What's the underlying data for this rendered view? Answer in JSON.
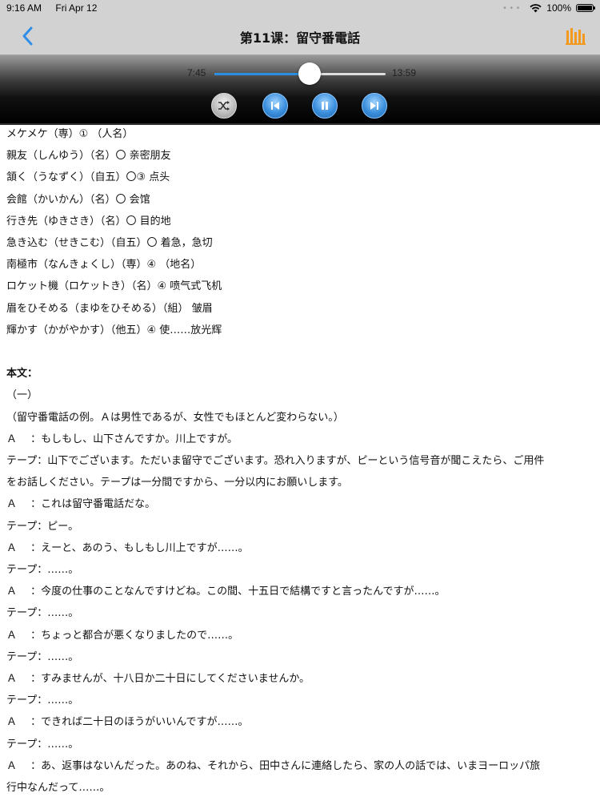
{
  "status": {
    "time": "9:16 AM",
    "date": "Fri Apr 12",
    "battery": "100%",
    "battery_level": 1.0
  },
  "nav": {
    "title": "第11课：留守番電話",
    "back_icon": "chevron-left-icon",
    "playlist_icon": "playlist-bars-icon",
    "accent": "#2f8ee8",
    "playlist_color": "#f39a1e"
  },
  "player": {
    "current_time": "7:45",
    "total_time": "13:59",
    "progress": 0.555,
    "buttons": [
      "shuffle-icon",
      "previous-icon",
      "pause-icon",
      "next-icon"
    ]
  },
  "vocab": [
    "メケメケ（専）① （人名）",
    "親友（しんゆう）（名）〇 亲密朋友",
    "頷く（うなずく）（自五）〇③ 点头",
    "会館（かいかん）（名）〇 会馆",
    "行き先（ゆきさき）（名）〇 目的地",
    "急き込む（せきこむ）（自五）〇 着急，急切",
    "南極市（なんきょくし）（専）④ （地名）",
    "ロケット機（ロケットき）（名）④ 喷气式飞机",
    "眉をひそめる（まゆをひそめる）（組） 皱眉",
    "輝かす（かがやかす）（他五）④ 使……放光辉"
  ],
  "text_heading": "本文：",
  "section": "（一）",
  "intro": "（留守番電話の例。Ａは男性であるが、女性でもほとんど変わらない。）",
  "dialogue": [
    "Ａ　 ：もしもし、山下さんですか。川上ですが。",
    "テープ：山下でございます。ただいま留守でございます。恐れ入りますが、ピーという信号音が聞こえたら、ご用件",
    "をお話しください。テープは一分間ですから、一分以内にお願いします。",
    "Ａ　 ：これは留守番電話だな。",
    "テープ：ピー。",
    "Ａ　 ：えーと、あのう、もしもし川上ですが……。",
    "テープ：……。",
    "Ａ　 ：今度の仕事のことなんですけどね。この間、十五日で結構ですと言ったんですが……。",
    "テープ：……。",
    "Ａ　 ：ちょっと都合が悪くなりましたので……。",
    "テープ：……。",
    "Ａ　 ：すみませんが、十八日か二十日にしてくださいませんか。",
    "テープ：……。",
    "Ａ　 ：できれば二十日のほうがいいんですが……。",
    "テープ：……。",
    "Ａ　 ：あ、返事はないんだった。あのね、それから、田中さんに連絡したら、家の人の話では、いまヨーロッパ旅",
    "行中なんだって……。"
  ]
}
